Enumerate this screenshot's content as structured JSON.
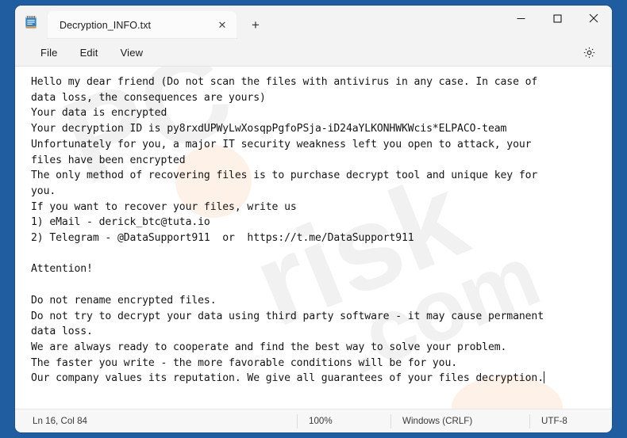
{
  "window": {
    "app_icon": "notepad-icon",
    "desktop_color": "#1f5da0",
    "window_bg": "#f3f3f3",
    "editor_bg": "#ffffff"
  },
  "tabs": [
    {
      "label": "Decryption_INFO.txt",
      "close_glyph": "✕",
      "active": true
    }
  ],
  "new_tab": {
    "label": "+",
    "icon": "plus-icon"
  },
  "caption": {
    "minimize": "minimize-icon",
    "maximize": "maximize-icon",
    "close": "close-icon"
  },
  "menubar": {
    "items": [
      {
        "label": "File"
      },
      {
        "label": "Edit"
      },
      {
        "label": "View"
      }
    ],
    "settings_icon": "gear-icon"
  },
  "watermark": {
    "text": "PCrisk.com",
    "color": "#f0f0f0"
  },
  "editor": {
    "content": "Hello my dear friend (Do not scan the files with antivirus in any case. In case of\ndata loss, the consequences are yours)\nYour data is encrypted\nYour decryption ID is py8rxdUPWyLwXosqpPgfoPSja-iD24aYLKONHWKWcis*ELPACO-team\nUnfortunately for you, a major IT security weakness left you open to attack, your\nfiles have been encrypted\nThe only method of recovering files is to purchase decrypt tool and unique key for\nyou.\nIf you want to recover your files, write us\n1) eMail - derick_btc@tuta.io\n2) Telegram - @DataSupport911  or  https://t.me/DataSupport911\n\nAttention!\n\nDo not rename encrypted files.\nDo not try to decrypt your data using third party software - it may cause permanent\ndata loss.\nWe are always ready to cooperate and find the best way to solve your problem.\nThe faster you write - the more favorable conditions will be for you.\nOur company values its reputation. We give all guarantees of your files decryption.",
    "decryption_id": "py8rxdUPWyLwXosqpPgfoPSja-iD24aYLKONHWKWcis*ELPACO-team",
    "email": "derick_btc@tuta.io",
    "telegram_handle": "@DataSupport911",
    "telegram_url": "https://t.me/DataSupport911",
    "has_caret": true
  },
  "statusbar": {
    "position": "Ln 16, Col 84",
    "zoom": "100%",
    "line_ending": "Windows (CRLF)",
    "encoding": "UTF-8"
  }
}
